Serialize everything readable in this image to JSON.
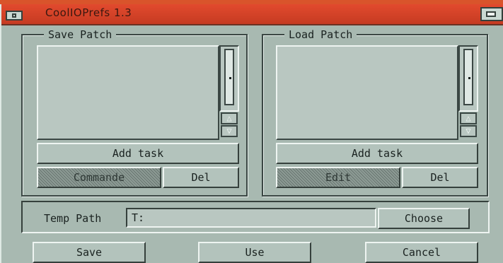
{
  "window": {
    "title": "CoolIOPrefs 1.3"
  },
  "save_patch": {
    "label": "Save Patch",
    "add_task": "Add task",
    "secondary": "Commande",
    "delete": "Del"
  },
  "load_patch": {
    "label": "Load Patch",
    "add_task": "Add task",
    "secondary": "Edit",
    "delete": "Del"
  },
  "temp_path": {
    "label": "Temp Path",
    "value": "T:",
    "choose": "Choose"
  },
  "footer": {
    "save": "Save",
    "use": "Use",
    "cancel": "Cancel"
  },
  "colors": {
    "window_bg": "#a8b9b1",
    "titlebar": "#e24a2e",
    "desktop": "#d9542b"
  }
}
